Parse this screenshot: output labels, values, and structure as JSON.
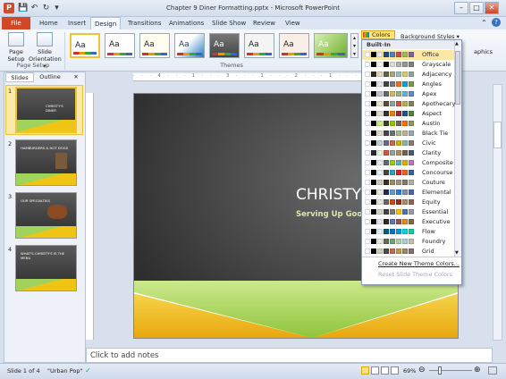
{
  "window": {
    "title": "Chapter 9 Diner Formatting.pptx - Microsoft PowerPoint",
    "app_icon": "P"
  },
  "qat": {
    "save": "💾",
    "undo": "↶",
    "redo": "↻",
    "customize": "▾"
  },
  "window_buttons": {
    "minimize": "–",
    "maximize": "□",
    "close": "✕"
  },
  "tabs": [
    "File",
    "Home",
    "Insert",
    "Design",
    "Transitions",
    "Animations",
    "Slide Show",
    "Review",
    "View"
  ],
  "active_tab": "Design",
  "ribbon": {
    "page_setup": {
      "page_setup_label": "Page Setup",
      "orientation_label": "Slide Orientation ▾",
      "group_label": "Page Setup"
    },
    "themes": {
      "group_label": "Themes",
      "items": [
        "Aa",
        "Aa",
        "Aa",
        "Aa",
        "Aa",
        "Aa",
        "Aa",
        "Aa"
      ]
    },
    "background_styles_label": "Background Styles ▾",
    "graphics_label": "aphics"
  },
  "colors_menu": {
    "button_label": "Colors ▾",
    "header": "Built-In",
    "selected": "Office",
    "schemes": [
      {
        "name": "Office",
        "colors": [
          "#ffffff",
          "#000000",
          "#eeece1",
          "#1f497d",
          "#4f81bd",
          "#c0504d",
          "#9bbb59",
          "#8064a2"
        ]
      },
      {
        "name": "Grayscale",
        "colors": [
          "#ffffff",
          "#000000",
          "#f8f8f8",
          "#000000",
          "#dddddd",
          "#b2b2b2",
          "#969696",
          "#808080"
        ]
      },
      {
        "name": "Adjacency",
        "colors": [
          "#ffffff",
          "#2f2b20",
          "#dfdcb7",
          "#675e47",
          "#a9a57c",
          "#9cbebd",
          "#d2cb6c",
          "#95a39d"
        ]
      },
      {
        "name": "Angles",
        "colors": [
          "#ffffff",
          "#000000",
          "#dde9ec",
          "#434342",
          "#797b7e",
          "#f96a1b",
          "#08a1d9",
          "#7c984a"
        ]
      },
      {
        "name": "Apex",
        "colors": [
          "#ffffff",
          "#000000",
          "#c9c2d1",
          "#69676d",
          "#ceb966",
          "#9cb084",
          "#6bb1c9",
          "#6585cf"
        ]
      },
      {
        "name": "Apothecary",
        "colors": [
          "#ffffff",
          "#000000",
          "#ece9c6",
          "#564b3c",
          "#93a299",
          "#cf543f",
          "#b5ae53",
          "#848058"
        ]
      },
      {
        "name": "Aspect",
        "colors": [
          "#ffffff",
          "#000000",
          "#e3ded1",
          "#323232",
          "#f07f09",
          "#9f2936",
          "#1b587c",
          "#4e8542"
        ]
      },
      {
        "name": "Austin",
        "colors": [
          "#ffffff",
          "#000000",
          "#caf278",
          "#3e3d2d",
          "#94c600",
          "#71685a",
          "#ff6700",
          "#909465"
        ]
      },
      {
        "name": "Black Tie",
        "colors": [
          "#ffffff",
          "#000000",
          "#e3dcc5",
          "#46464a",
          "#6f6f74",
          "#a7b789",
          "#beae98",
          "#92a9b9"
        ]
      },
      {
        "name": "Civic",
        "colors": [
          "#ffffff",
          "#000000",
          "#c5d1d7",
          "#646b86",
          "#d16349",
          "#ccb400",
          "#8cadae",
          "#8c7b70"
        ]
      },
      {
        "name": "Clarity",
        "colors": [
          "#ffffff",
          "#292934",
          "#f3f2dc",
          "#d2533c",
          "#93a299",
          "#ad8f67",
          "#726056",
          "#4c5a6a"
        ]
      },
      {
        "name": "Composite",
        "colors": [
          "#ffffff",
          "#000000",
          "#e7ecef",
          "#5b6973",
          "#98c723",
          "#59b0b9",
          "#deae00",
          "#b77bb4"
        ]
      },
      {
        "name": "Concourse",
        "colors": [
          "#ffffff",
          "#000000",
          "#def5fa",
          "#464646",
          "#2da2bf",
          "#da1f28",
          "#eb641b",
          "#39639d"
        ]
      },
      {
        "name": "Couture",
        "colors": [
          "#ffffff",
          "#000000",
          "#d0ccb9",
          "#37302a",
          "#9e8e5c",
          "#a09781",
          "#85776d",
          "#aeafa9"
        ]
      },
      {
        "name": "Elemental",
        "colors": [
          "#ffffff",
          "#000000",
          "#eeecde",
          "#242852",
          "#629dd1",
          "#297fd5",
          "#7f8fa9",
          "#4a66ac"
        ]
      },
      {
        "name": "Equity",
        "colors": [
          "#ffffff",
          "#000000",
          "#e9e5dc",
          "#696464",
          "#d34817",
          "#9b2d1f",
          "#a28e6a",
          "#956251"
        ]
      },
      {
        "name": "Essential",
        "colors": [
          "#ffffff",
          "#000000",
          "#d5d2c1",
          "#424242",
          "#7a7a7a",
          "#f5c201",
          "#526db0",
          "#989aac"
        ]
      },
      {
        "name": "Executive",
        "colors": [
          "#ffffff",
          "#000000",
          "#e4e8ee",
          "#2f2b20",
          "#6076b4",
          "#9c5252",
          "#e68422",
          "#846648"
        ]
      },
      {
        "name": "Flow",
        "colors": [
          "#ffffff",
          "#000000",
          "#dbf5f9",
          "#04617b",
          "#0f6fc6",
          "#009dd9",
          "#0bd0d9",
          "#10cf9b"
        ]
      },
      {
        "name": "Foundry",
        "colors": [
          "#ffffff",
          "#000000",
          "#eaebde",
          "#676a55",
          "#72a376",
          "#b0ccb0",
          "#a8cdd7",
          "#c0beaf"
        ]
      },
      {
        "name": "Grid",
        "colors": [
          "#ffffff",
          "#000000",
          "#ccd1b9",
          "#534949",
          "#c66951",
          "#bf974d",
          "#928b70",
          "#87706b"
        ]
      }
    ],
    "create_new": "Create New Theme Colors...",
    "reset": "Reset Slide Theme Colors"
  },
  "pane": {
    "tab_slides": "Slides",
    "tab_outline": "Outline",
    "close": "✕",
    "slides": [
      {
        "num": "1",
        "title": "CHRISTY'S DINER"
      },
      {
        "num": "2",
        "title": "HAMBURGERS & HOT DOGS"
      },
      {
        "num": "3",
        "title": "OUR SPECIALTIES"
      },
      {
        "num": "4",
        "title": "WHAT'S CHRISTY'S IS THE MENU"
      }
    ]
  },
  "slide": {
    "title": "CHRISTY'",
    "subtitle": "Serving Up Good"
  },
  "notes": {
    "placeholder": "Click to add notes"
  },
  "statusbar": {
    "slide": "Slide 1 of 4",
    "theme": "\"Urban Pop\"",
    "zoom": "69%"
  },
  "ruler_ticks": "· · · 4 · · · 1 · · · 3 · · · 1 · · · 2 · · · 1 · · · 1 · · · 1 · · · 0 · · · 1"
}
